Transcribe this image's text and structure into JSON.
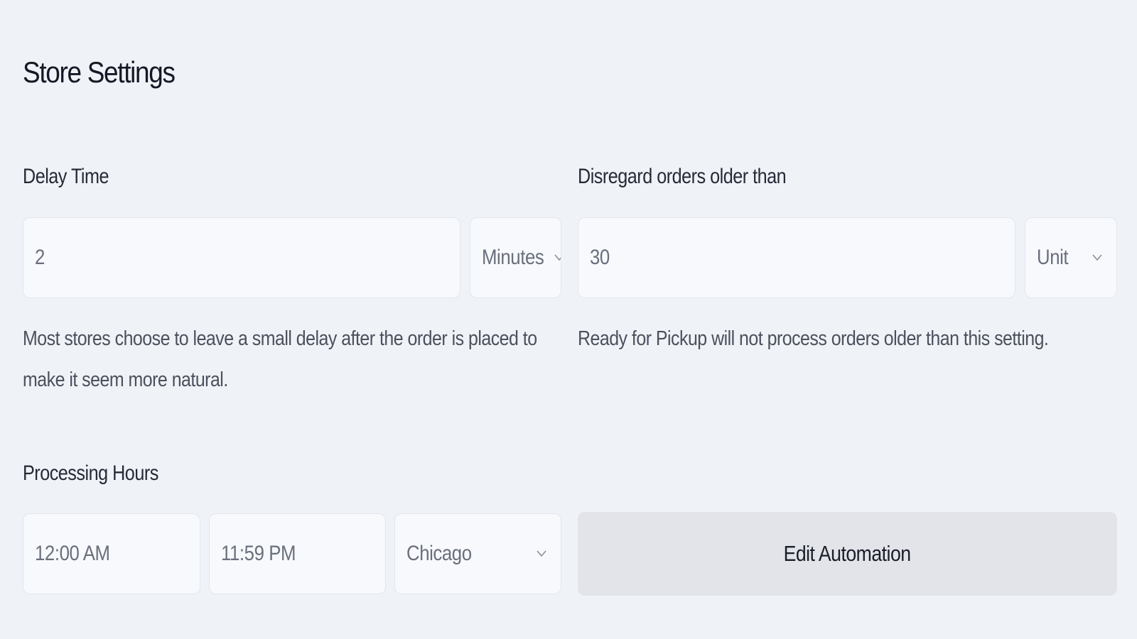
{
  "page": {
    "title": "Store Settings"
  },
  "delay_time": {
    "label": "Delay Time",
    "value": "2",
    "unit": "Minutes",
    "helper": "Most stores choose to leave a small delay after the order is placed to make it seem more natural."
  },
  "disregard_orders": {
    "label": "Disregard orders older than",
    "value": "30",
    "unit": "Unit",
    "helper": "Ready for Pickup will not process orders older than this setting."
  },
  "processing_hours": {
    "label": "Processing Hours",
    "start_time": "12:00 AM",
    "end_time": "11:59 PM",
    "timezone": "Chicago"
  },
  "actions": {
    "edit_automation_label": "Edit Automation"
  },
  "icons": {
    "chevron": "chevron-down-icon"
  },
  "colors": {
    "background": "#eff2f7",
    "field_background": "#f7f9fc",
    "field_border": "#e3e7ee",
    "button_background": "#e2e4e9"
  }
}
